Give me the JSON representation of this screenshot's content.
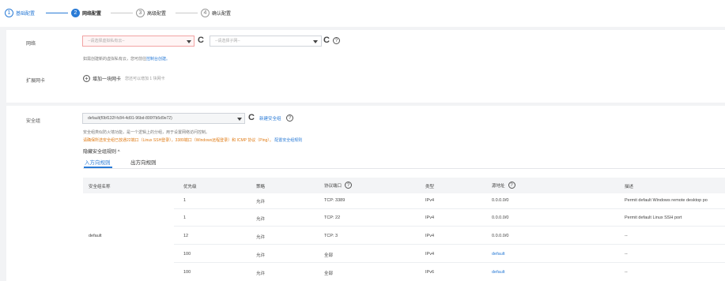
{
  "steps": [
    {
      "num": "1",
      "label": "基础配置"
    },
    {
      "num": "2",
      "label": "网络配置"
    },
    {
      "num": "3",
      "label": "高级配置"
    },
    {
      "num": "4",
      "label": "确认配置"
    }
  ],
  "network": {
    "label": "网络",
    "vpc_placeholder": "--请选择虚拟私有云--",
    "subnet_placeholder": "--请选择子网--",
    "hint_prefix": "如需创建新的虚拟私有云，您可前往",
    "hint_link": "控制台创建。"
  },
  "nic": {
    "label": "扩展网卡",
    "add_label": "增加一块网卡",
    "add_hint": "您还可以增加 1 块网卡"
  },
  "security": {
    "label": "安全组",
    "selected_group": "default(f0bf132f-fc84-4d91-96bd-800f7b5d9e72)",
    "new_group_link": "新建安全组",
    "desc_line1": "安全组类似防火墙功能，是一个逻辑上的分组，用于设置网络访问控制。",
    "desc_line2_warn": "请确保所选安全组已放通22端口（Linux SSH登录），3389端口（Windows远程登录）和 ICMP 协议（Ping）。",
    "desc_line2_link": "配置安全组规则",
    "hide_rules": "隐藏安全组规则",
    "tab_inbound": "入方向规则",
    "tab_outbound": "出方向规则"
  },
  "table": {
    "headers": [
      "安全组名称",
      "优先级",
      "策略",
      "协议端口",
      "类型",
      "源地址",
      "描述"
    ],
    "group_name": "default",
    "rows": [
      {
        "priority": "1",
        "policy": "允许",
        "port": "TCP: 3389",
        "type": "IPv4",
        "source": "0.0.0.0/0",
        "desc": "Permit default Windows remote desktop po"
      },
      {
        "priority": "1",
        "policy": "允许",
        "port": "TCP: 22",
        "type": "IPv4",
        "source": "0.0.0.0/0",
        "desc": "Permit default Linux SSH port"
      },
      {
        "priority": "12",
        "policy": "允许",
        "port": "TCP: 3",
        "type": "IPv4",
        "source": "0.0.0.0/0",
        "desc": "--"
      },
      {
        "priority": "100",
        "policy": "允许",
        "port": "全部",
        "type": "IPv4",
        "source": "default",
        "desc": "--"
      },
      {
        "priority": "100",
        "policy": "允许",
        "port": "全部",
        "type": "IPv6",
        "source": "default",
        "desc": "--"
      }
    ]
  },
  "colors": {
    "accent": "#2a7bd6",
    "warning": "#e07b15",
    "error_border": "#f2a3a3"
  }
}
